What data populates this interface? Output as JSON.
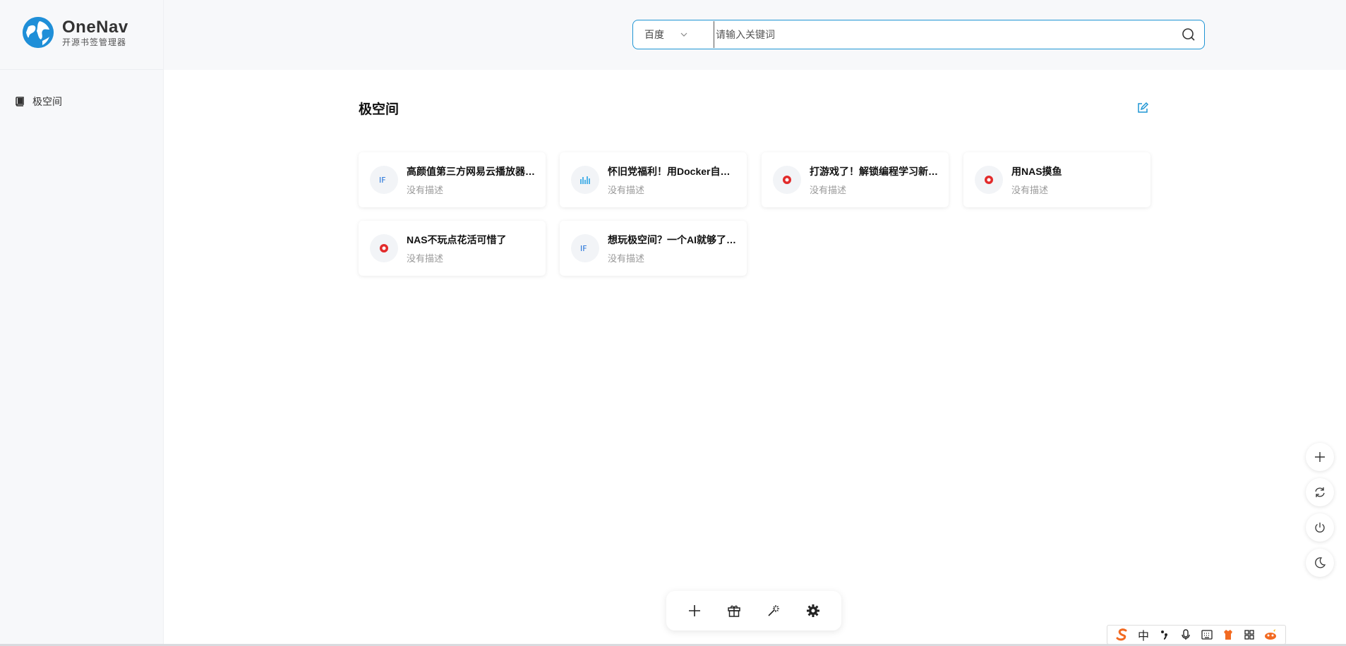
{
  "brand": {
    "name": "OneNav",
    "tagline": "开源书签管理器"
  },
  "sidebar": {
    "items": [
      {
        "label": "极空间",
        "icon": "book-icon"
      }
    ]
  },
  "search": {
    "engine": "百度",
    "placeholder": "请输入关键词",
    "value": ""
  },
  "section": {
    "title": "极空间"
  },
  "cards": [
    {
      "title": "高颜值第三方网易云播放器…",
      "desc": "没有描述",
      "icon": "zhihu-favicon-icon"
    },
    {
      "title": "怀旧党福利！用Docker自…",
      "desc": "没有描述",
      "icon": "chart-favicon-icon"
    },
    {
      "title": "打游戏了！解锁编程学习新…",
      "desc": "没有描述",
      "icon": "red-logo-favicon-icon"
    },
    {
      "title": "用NAS摸鱼",
      "desc": "没有描述",
      "icon": "red-logo-favicon-icon"
    },
    {
      "title": "NAS不玩点花活可惜了",
      "desc": "没有描述",
      "icon": "red-logo-favicon-icon"
    },
    {
      "title": "想玩极空间？一个AI就够了…",
      "desc": "没有描述",
      "icon": "zhihu-favicon-icon"
    }
  ],
  "toolbar": {
    "items": [
      "plus-icon",
      "gift-icon",
      "sparkle-icon",
      "gear-icon"
    ]
  },
  "float_buttons": [
    "plus-icon",
    "refresh-icon",
    "power-icon",
    "moon-icon"
  ],
  "ime": {
    "mode": "中"
  },
  "colors": {
    "accent": "#1e95d4",
    "sidebar_bg": "#f7f8fa"
  }
}
